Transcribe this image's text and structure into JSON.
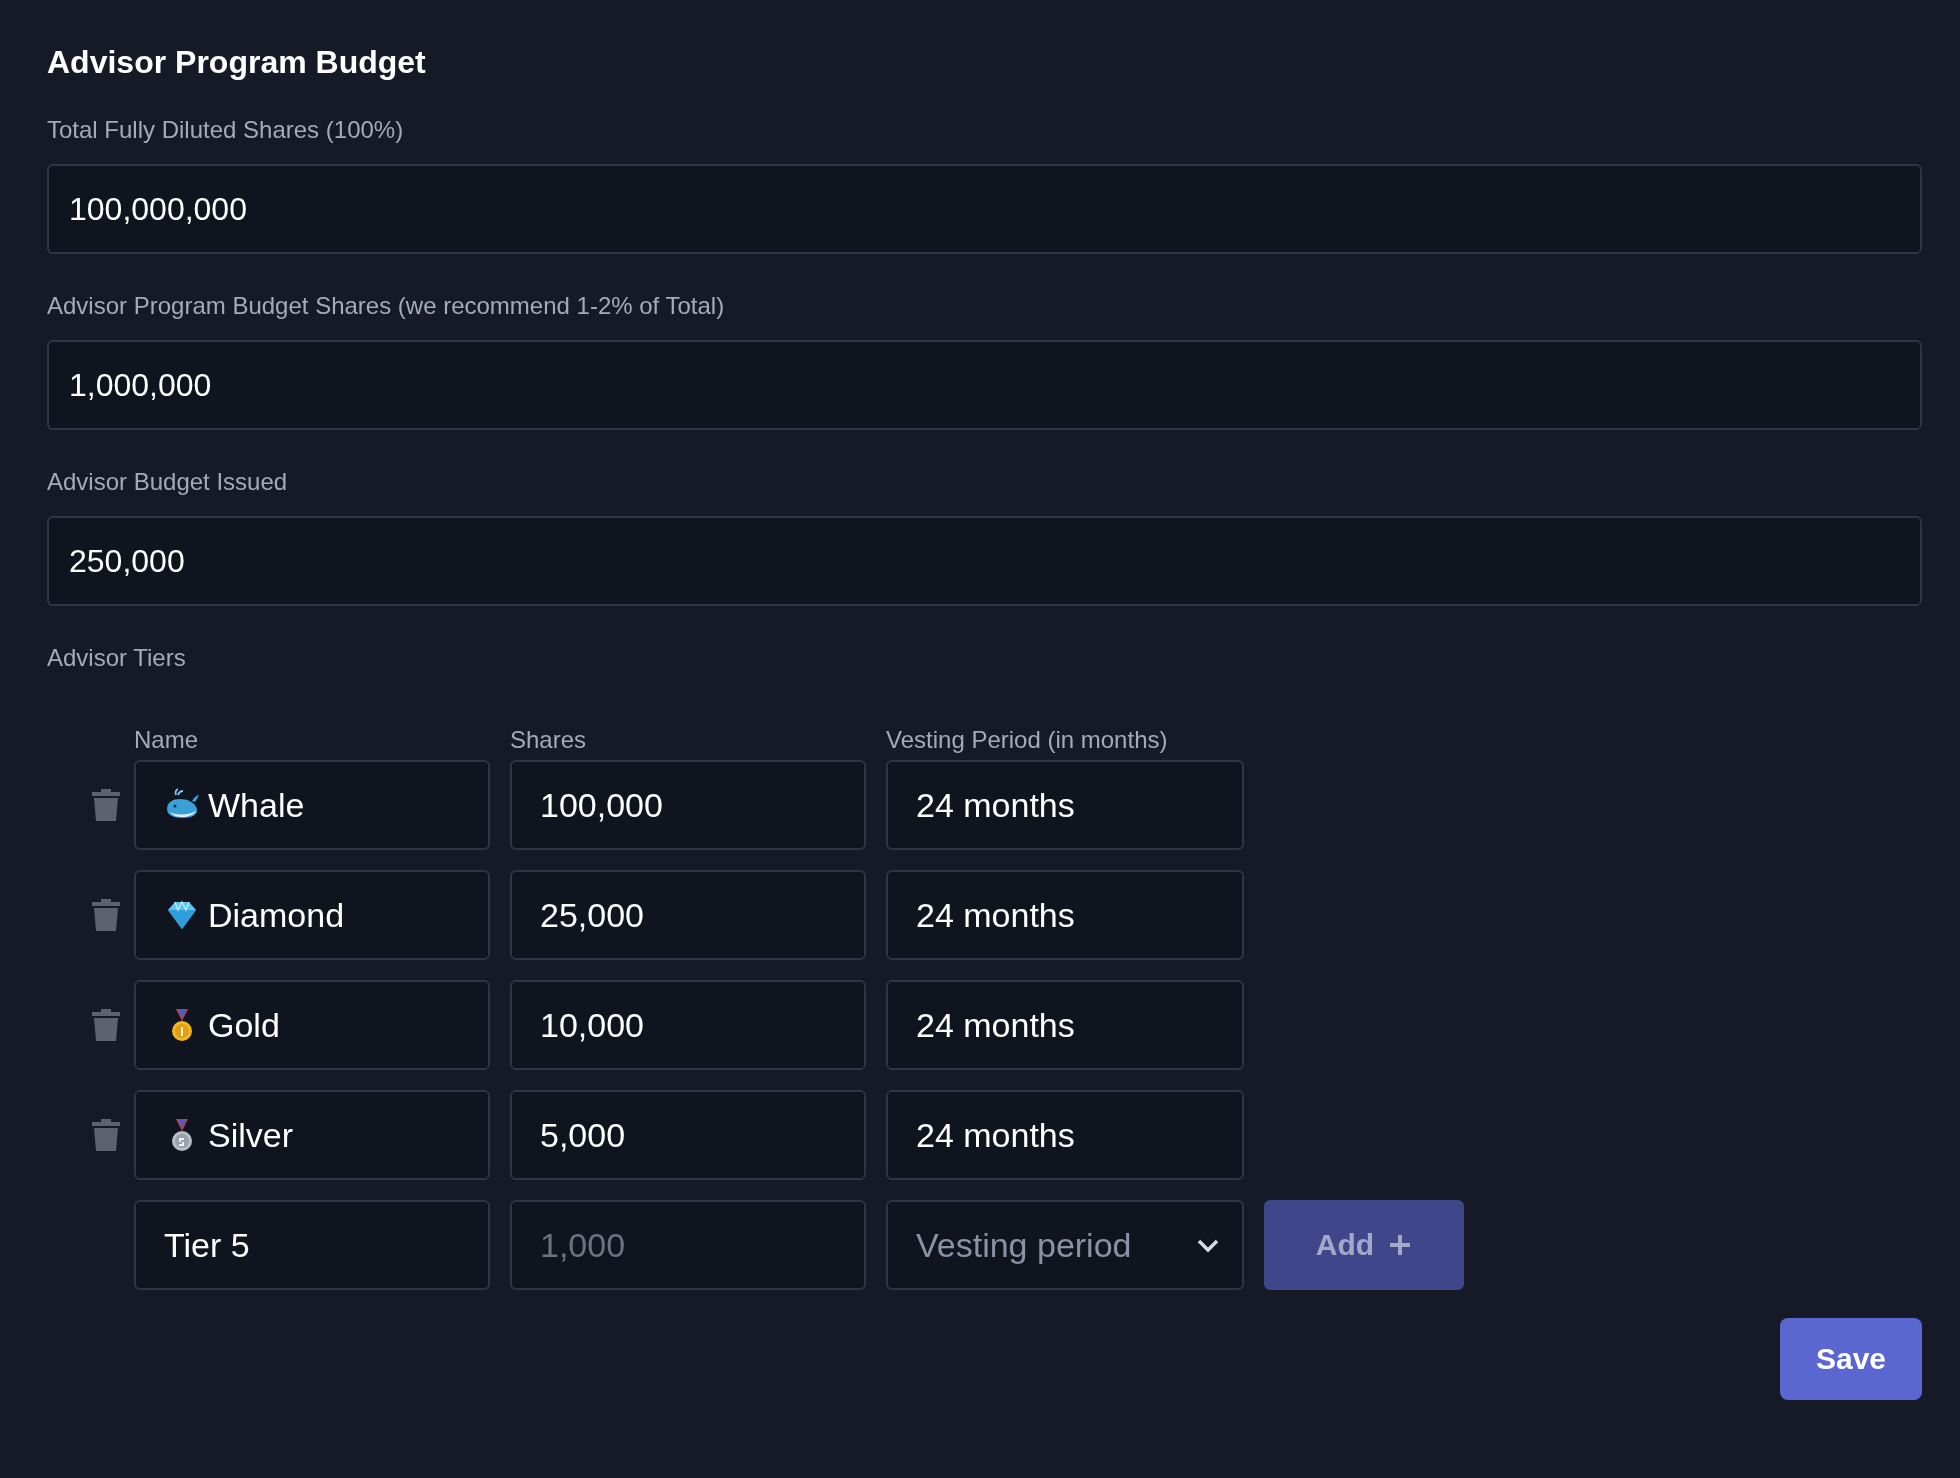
{
  "title": "Advisor Program Budget",
  "fields": [
    {
      "label": "Total Fully Diluted Shares (100%)",
      "value": "100,000,000"
    },
    {
      "label": "Advisor Program Budget Shares (we recommend 1-2% of Total)",
      "value": "1,000,000"
    },
    {
      "label": "Advisor Budget Issued",
      "value": "250,000"
    }
  ],
  "tiers": {
    "label": "Advisor Tiers",
    "columns": [
      "Name",
      "Shares",
      "Vesting Period (in months)"
    ],
    "rows": [
      {
        "kind": "whale",
        "name": "Whale",
        "shares": "100,000",
        "vesting": "24 months"
      },
      {
        "kind": "diamond",
        "name": "Diamond",
        "shares": "25,000",
        "vesting": "24 months"
      },
      {
        "kind": "gold",
        "name": "Gold",
        "shares": "10,000",
        "vesting": "24 months"
      },
      {
        "kind": "silver",
        "name": "Silver",
        "shares": "5,000",
        "vesting": "24 months"
      }
    ],
    "new_row": {
      "name": "Tier 5",
      "shares_placeholder": "1,000",
      "vesting_placeholder": "Vesting period",
      "add_button": {
        "label": "Add",
        "disabled": true
      }
    }
  },
  "save_button": "Save"
}
